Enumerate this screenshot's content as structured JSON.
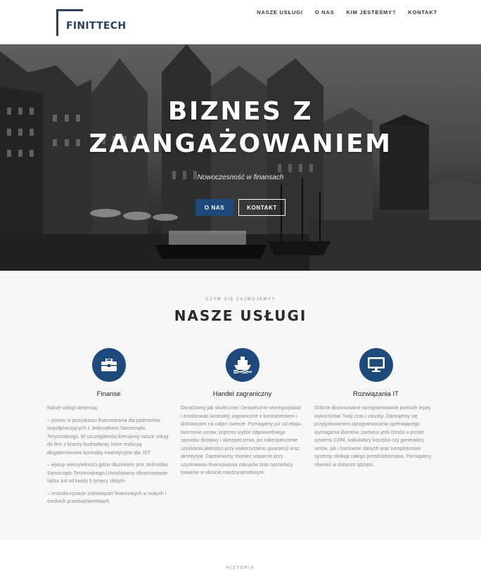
{
  "header": {
    "logo_text": "FINITTECH",
    "nav": [
      "NASZE USŁUGI",
      "O NAS",
      "KIM JESTEŚMY?",
      "KONTAKT"
    ]
  },
  "hero": {
    "title_line1": "BIZNES Z",
    "title_line2": "ZAANGAŻOWANIEM",
    "subtitle": "Nowoczesność w finansach",
    "btn_primary": "O NAS",
    "btn_secondary": "KONTAKT"
  },
  "services": {
    "eyebrow": "CZYM SIĘ ZAJMUJEMY?",
    "title": "NASZE USŁUGI",
    "items": [
      {
        "icon": "briefcase-icon",
        "title": "Finanse",
        "paragraphs": [
          "Nasze usługi obejmują:",
          "–   pomoc w pozyskaniu finansowania dla podmiotów współpracujących z Jednostkami Samorządu Terytorialnego. W szczególności kierujemy nasze usługi do firm z branży budowlanej, które realizują długoterminowe kontrakty inwestycyjne dla JST",
          "– wykup wierzytelności gdzie dłużnikiem jest Jednostka Samorządu Terytorialnego.Umożliwiamy sfinansowanie faktur już od kwoty 5 tysięcy złotych",
          "– restrukturyzacje zobowiązań finansowych w małych i średnich przedsiębiorstwach."
        ]
      },
      {
        "icon": "ship-icon",
        "title": "Handel zagraniczny",
        "paragraphs": [
          "Doradzamy jak skutecznie i bezpiecznie wynegocjować i zrealizować kontrakty zagraniczne z kontrahentami i dostawcami na całym świecie. Pomagamy już od etapu tworzenie umów, poprzez wybór odpowiedniego sposobu dostawy i ubezpieczenia, po zabezpieczenie uzyskania płatności przy wykorzystaniu gwarancji oraz akredytyw. Zapewniamy również wsparcie przy uzyskiwaniu finansowania zakupów oraz sprzedaży towarów w obrocie międzynarodowym."
        ]
      },
      {
        "icon": "monitor-icon",
        "title": "Rozwiązania IT",
        "paragraphs": [
          "Dobrze dostosowane oprogramowanie pomoże lepiej wykorzystać Twój czas i zasoby. Zajmujemy się przygotowaniem oprogramowania spełniającego wymagania klientów, zarówno jeśli chodzi o proste systemy CRM, kalkulatory kosztów czy generatory umów, jak i hurtownie danych oraz kompleksowe systemy obsługi całego przedsiębiorstwa. Pomagamy również w doborze sprzętu."
        ]
      }
    ]
  },
  "history": {
    "eyebrow": "HISTORIA"
  },
  "colors": {
    "accent": "#1d4a7b",
    "logo": "#2b3f5c"
  }
}
